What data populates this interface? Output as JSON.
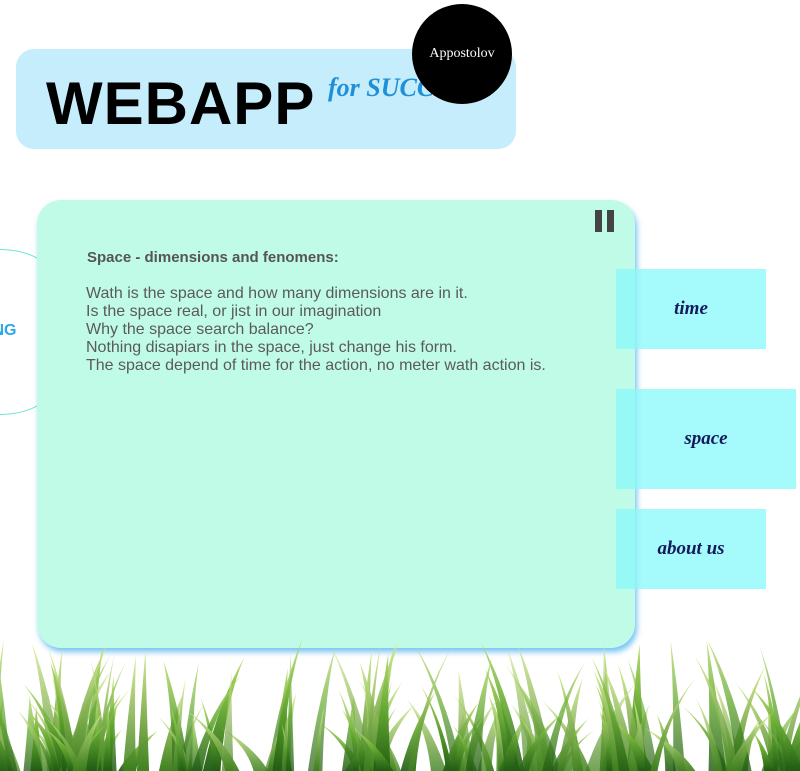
{
  "header": {
    "title": "WEBAPP",
    "tagline": "for SUCCESS",
    "author": "Appostolov"
  },
  "side_menu": {
    "label": "INING"
  },
  "pause": {
    "icon": "pause-icon"
  },
  "content": {
    "heading": "Space - dimensions and fenomens:",
    "lines": [
      "Wath is the space and how many dimensions are in it.",
      "Is the space real, or jist in our imagination",
      "Why the space search balance?",
      "Nothing disapiars in the space, just change his form.",
      "The space depend of time for the action, no meter wath action is."
    ]
  },
  "nav": {
    "items": [
      {
        "label": "time"
      },
      {
        "label": "space"
      },
      {
        "label": "about us"
      }
    ]
  },
  "colors": {
    "header_bg": "#c5edfb",
    "panel_bg": "#c0fbe8",
    "tab_bg": "#8cf8fa",
    "tagline": "#1f8fd8",
    "nav_text": "#141a5c"
  }
}
